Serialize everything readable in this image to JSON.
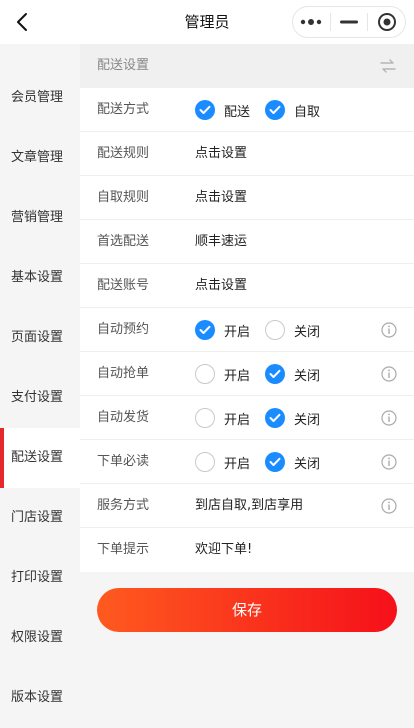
{
  "header": {
    "title": "管理员",
    "back_icon": "chevron-left-icon"
  },
  "capsule": {
    "more_icon": "more-dots-icon",
    "minimize_icon": "minimize-icon",
    "close_icon": "target-circle-icon"
  },
  "sidebar": {
    "items": [
      {
        "label": "会员管理",
        "active": false
      },
      {
        "label": "文章管理",
        "active": false
      },
      {
        "label": "营销管理",
        "active": false
      },
      {
        "label": "基本设置",
        "active": false
      },
      {
        "label": "页面设置",
        "active": false
      },
      {
        "label": "支付设置",
        "active": false
      },
      {
        "label": "配送设置",
        "active": true
      },
      {
        "label": "门店设置",
        "active": false
      },
      {
        "label": "打印设置",
        "active": false
      },
      {
        "label": "权限设置",
        "active": false
      },
      {
        "label": "版本设置",
        "active": false
      }
    ]
  },
  "section": {
    "title": "配送设置",
    "swap_icon": "swap-arrows-icon"
  },
  "form": {
    "delivery_method": {
      "label": "配送方式",
      "options": [
        "配送",
        "自取"
      ],
      "checked": [
        true,
        true
      ]
    },
    "delivery_rule": {
      "label": "配送规则",
      "value": "点击设置"
    },
    "pickup_rule": {
      "label": "自取规则",
      "value": "点击设置"
    },
    "preferred_delivery": {
      "label": "首选配送",
      "value": "顺丰速运"
    },
    "delivery_account": {
      "label": "配送账号",
      "value": "点击设置"
    },
    "auto_booking": {
      "label": "自动预约",
      "options": [
        "开启",
        "关闭"
      ],
      "selected": "开启"
    },
    "auto_grab": {
      "label": "自动抢单",
      "options": [
        "开启",
        "关闭"
      ],
      "selected": "关闭"
    },
    "auto_ship": {
      "label": "自动发货",
      "options": [
        "开启",
        "关闭"
      ],
      "selected": "关闭"
    },
    "must_read": {
      "label": "下单必读",
      "options": [
        "开启",
        "关闭"
      ],
      "selected": "关闭"
    },
    "service_mode": {
      "label": "服务方式",
      "value": "到店自取,到店享用"
    },
    "order_tip": {
      "label": "下单提示",
      "value": "欢迎下单!"
    }
  },
  "actions": {
    "save_label": "保存"
  },
  "colors": {
    "accent_blue": "#1a8cff",
    "active_red": "#e5282c",
    "save_start": "#ff5a1f",
    "save_end": "#f5101a"
  }
}
